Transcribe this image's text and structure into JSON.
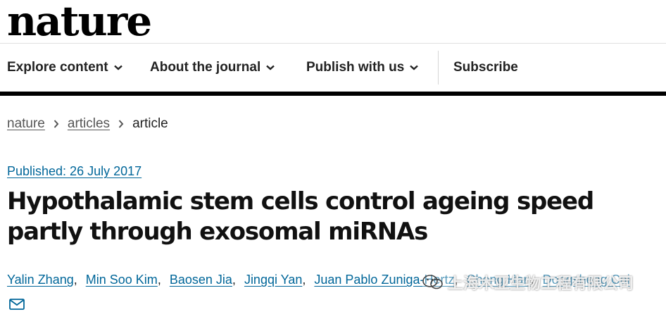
{
  "header": {
    "logo_text": "nature"
  },
  "nav": {
    "items": [
      {
        "label": "Explore content",
        "icon": "chevron-down-icon"
      },
      {
        "label": "About the journal",
        "icon": "chevron-down-icon"
      },
      {
        "label": "Publish with us",
        "icon": "chevron-down-icon"
      }
    ],
    "subscribe": "Subscribe"
  },
  "breadcrumb": [
    "nature",
    "articles",
    "article"
  ],
  "article": {
    "published": "Published: 26 July 2017",
    "title": "Hypothalamic stem cells control ageing speed partly through exosomal miRNAs",
    "authors": [
      "Yalin Zhang",
      "Min Soo Kim",
      "Baosen Jia",
      "Jingqi Yan",
      "Juan Pablo Zuniga-Hertz",
      "Cheng Han",
      "Dongsheng Cai"
    ]
  },
  "watermark": {
    "text": "上海木亚生物工程有限公司",
    "icon": "wechat-icon"
  },
  "colors": {
    "link": "#006699",
    "rule": "#000000",
    "text": "#222222"
  }
}
